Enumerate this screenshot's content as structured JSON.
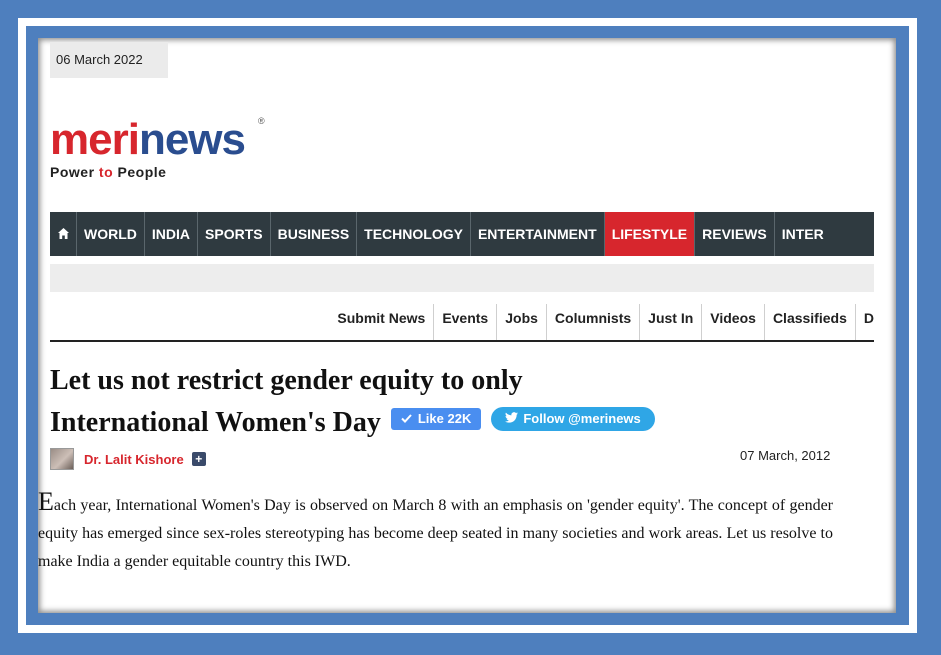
{
  "page_date": "06 March 2022",
  "logo": {
    "part1": "meri",
    "part2": "news",
    "reg": "®",
    "tag_part1": "Power ",
    "tag_to": "to",
    "tag_part2": " People"
  },
  "nav": {
    "home_icon": "home-icon",
    "items": [
      "WORLD",
      "INDIA",
      "SPORTS",
      "BUSINESS",
      "TECHNOLOGY",
      "ENTERTAINMENT",
      "LIFESTYLE",
      "REVIEWS",
      "INTER"
    ],
    "active": "LIFESTYLE"
  },
  "subnav": [
    "Submit News",
    "Events",
    "Jobs",
    "Columnists",
    "Just In",
    "Videos",
    "Classifieds",
    "D"
  ],
  "article": {
    "title_line1": "Let us not restrict gender equity to only",
    "title_line2": "International Women's Day",
    "like_label": "Like 22K",
    "follow_label": "Follow @merinews",
    "author": "Dr. Lalit Kishore",
    "date": "07 March, 2012",
    "dropcap": "E",
    "body": "ach year, International Women's Day is observed on March 8 with an emphasis on 'gender equity'. The concept of gender equity has emerged since sex-roles stereotyping has become deep seated in many societies and work areas. Let us resolve to make India a gender equitable country this IWD."
  },
  "colors": {
    "accent_red": "#d7262d",
    "nav_bg": "#2f3a40",
    "frame_blue": "#4e7fbe",
    "like_blue": "#4a8ef0",
    "twitter_blue": "#2fa6e6"
  }
}
